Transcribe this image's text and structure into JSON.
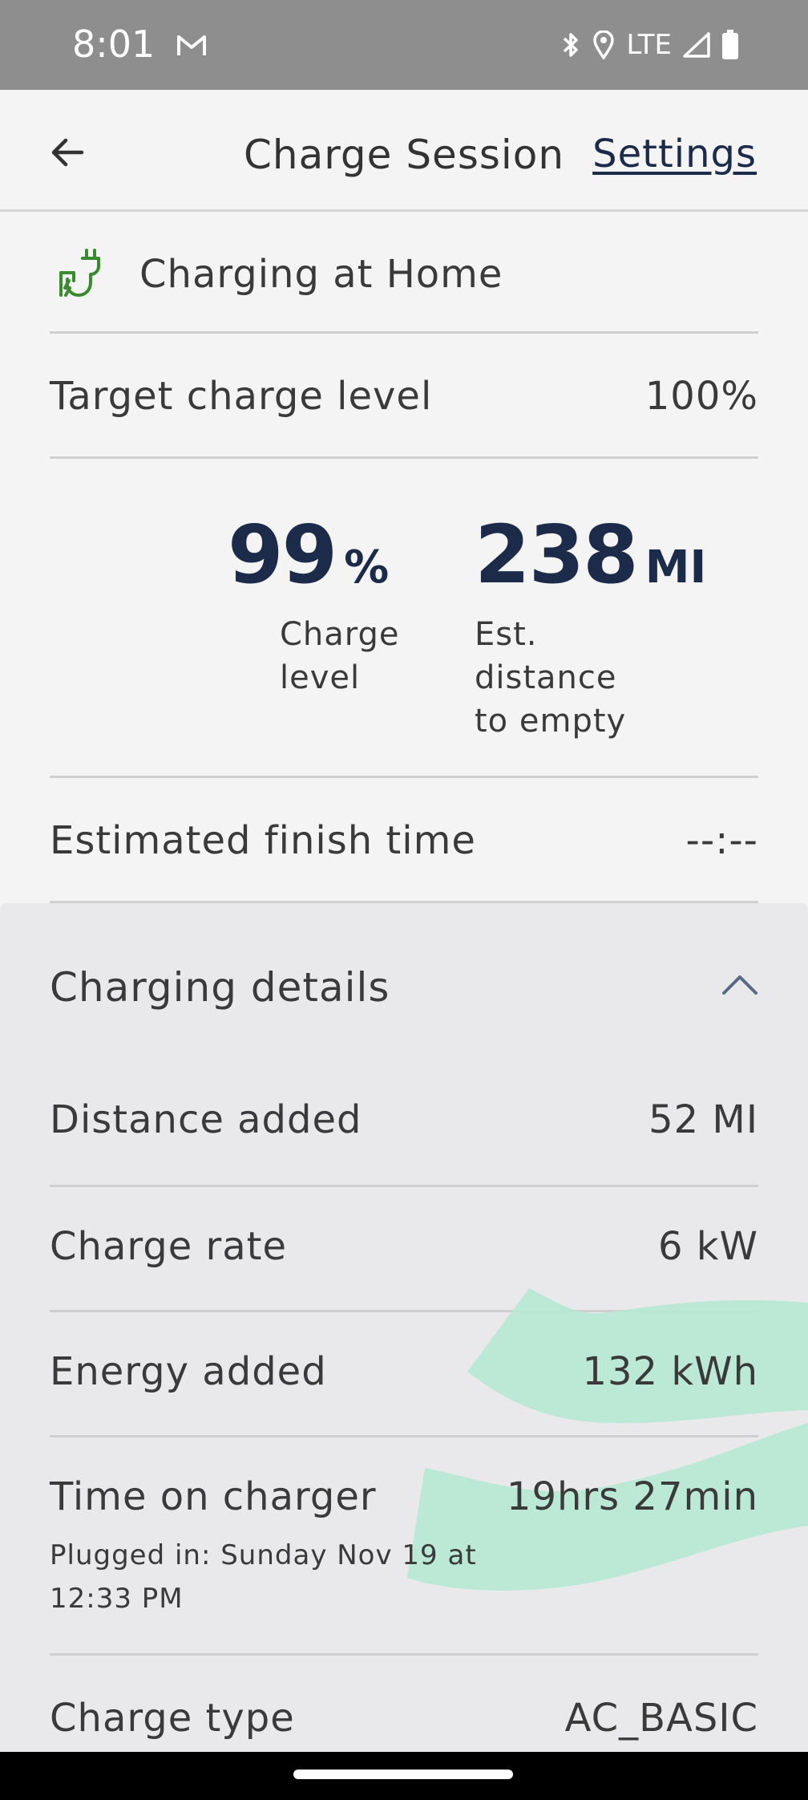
{
  "status_bar": {
    "time": "8:01",
    "network": "LTE",
    "icons": [
      "gmail-icon",
      "bluetooth-icon",
      "location-icon",
      "signal-icon",
      "battery-icon"
    ]
  },
  "header": {
    "back_icon": "arrow-left-icon",
    "title": "Charge Session",
    "settings_label": "Settings"
  },
  "location": {
    "icon": "charging-plug-icon",
    "label": "Charging at Home",
    "icon_color": "#3a8a2e"
  },
  "target": {
    "label": "Target charge level",
    "value": "100%"
  },
  "stats": {
    "charge_value": "99",
    "charge_unit": "%",
    "charge_caption_1": "Charge",
    "charge_caption_2": "level",
    "distance_value": "238",
    "distance_unit": "MI",
    "distance_caption_1": "Est.",
    "distance_caption_2": "distance",
    "distance_caption_3": "to empty",
    "accent_color": "#1d2b4a"
  },
  "finish": {
    "label": "Estimated finish time",
    "value": "--:--"
  },
  "details": {
    "title": "Charging details",
    "toggle_icon": "chevron-up-icon",
    "rows": [
      {
        "label": "Distance added",
        "value": "52 MI"
      },
      {
        "label": "Charge rate",
        "value": "6 kW"
      },
      {
        "label": "Energy added",
        "value": "132 kWh"
      },
      {
        "label": "Time on charger",
        "value": "19hrs 27min",
        "sub_1": "Plugged in: Sunday Nov 19 at",
        "sub_2": "12:33 PM"
      },
      {
        "label": "Charge type",
        "value": "AC_BASIC"
      }
    ]
  },
  "annotation_color": "#a8e6cc"
}
